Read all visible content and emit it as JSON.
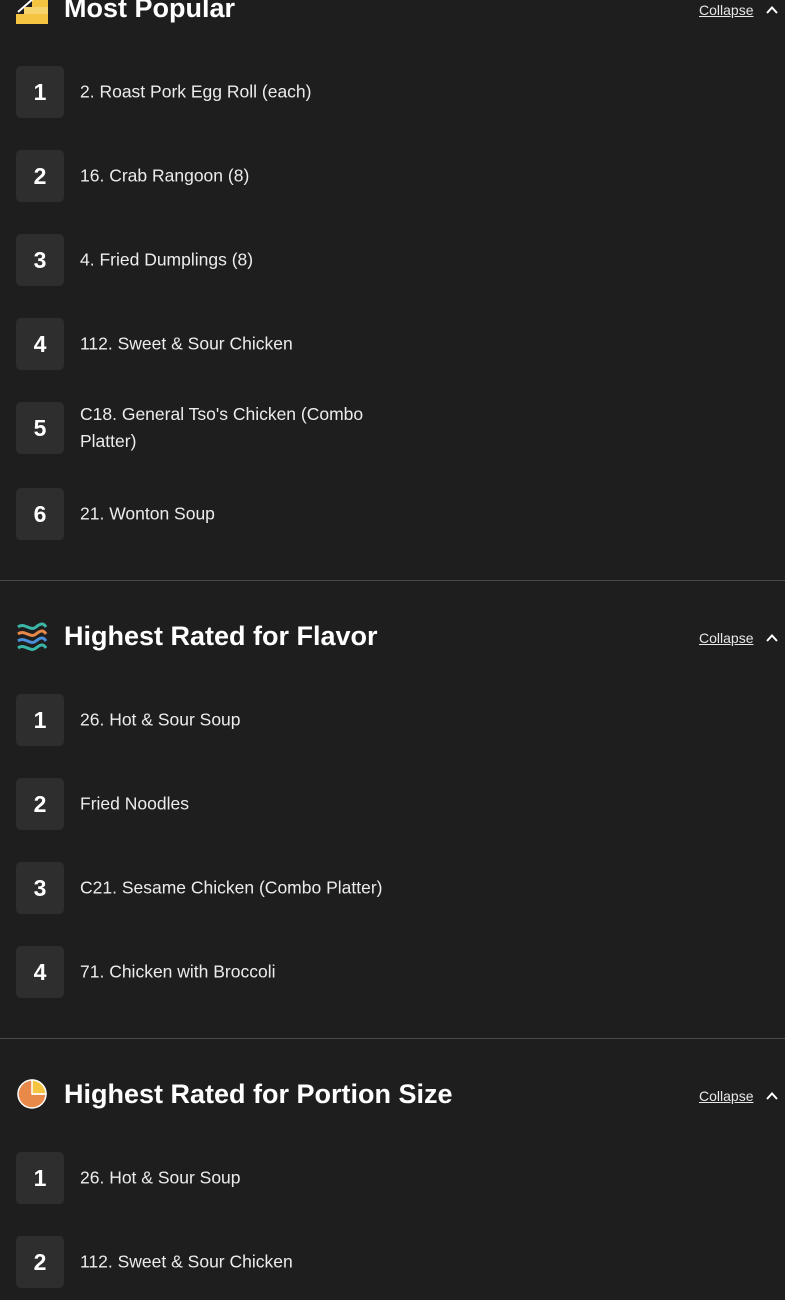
{
  "sections": [
    {
      "title": "Most Popular",
      "icon": "stairs-chart-icon",
      "collapse_label": "Collapse",
      "items": [
        {
          "rank": "1",
          "name": "2. Roast Pork Egg Roll (each)"
        },
        {
          "rank": "2",
          "name": "16. Crab Rangoon (8)"
        },
        {
          "rank": "3",
          "name": "4. Fried Dumplings (8)"
        },
        {
          "rank": "4",
          "name": "112. Sweet & Sour Chicken"
        },
        {
          "rank": "5",
          "name": "C18. General Tso's Chicken (Combo Platter)"
        },
        {
          "rank": "6",
          "name": "21. Wonton Soup"
        }
      ]
    },
    {
      "title": "Highest Rated for Flavor",
      "icon": "flavor-waves-icon",
      "collapse_label": "Collapse",
      "items": [
        {
          "rank": "1",
          "name": "26. Hot & Sour Soup"
        },
        {
          "rank": "2",
          "name": "Fried Noodles"
        },
        {
          "rank": "3",
          "name": "C21. Sesame Chicken (Combo Platter)"
        },
        {
          "rank": "4",
          "name": "71. Chicken with Broccoli"
        }
      ]
    },
    {
      "title": "Highest Rated for Portion Size",
      "icon": "pie-chart-icon",
      "collapse_label": "Collapse",
      "items": [
        {
          "rank": "1",
          "name": "26. Hot & Sour Soup"
        },
        {
          "rank": "2",
          "name": "112. Sweet & Sour Chicken"
        }
      ]
    }
  ],
  "colors": {
    "background": "#1e1e1e",
    "rank_box": "#2e2e2e",
    "divider": "#4a4a4a",
    "icon_yellow": "#f5c542",
    "icon_orange": "#e8894a",
    "icon_teal": "#3ab7a8",
    "icon_blue": "#4a8fd8"
  }
}
